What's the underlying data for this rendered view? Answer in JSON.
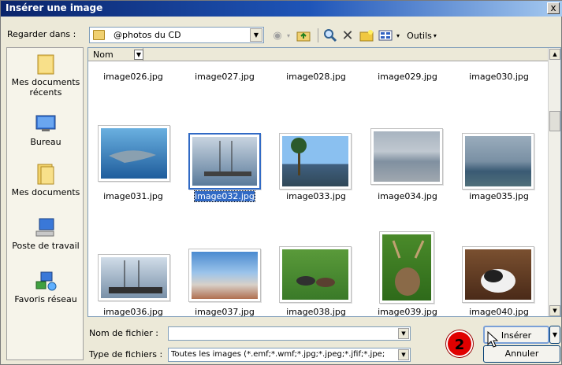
{
  "window": {
    "title": "Insérer une image",
    "close_label": "x"
  },
  "toolbar": {
    "look_in_label": "Regarder dans :",
    "look_in_value": "@photos du CD",
    "tools_label": "Outils"
  },
  "places": [
    {
      "label": "Mes documents récents",
      "icon": "recent-documents-icon"
    },
    {
      "label": "Bureau",
      "icon": "desktop-icon"
    },
    {
      "label": "Mes documents",
      "icon": "my-documents-icon"
    },
    {
      "label": "Poste de travail",
      "icon": "my-computer-icon"
    },
    {
      "label": "Favoris réseau",
      "icon": "network-places-icon"
    }
  ],
  "files": {
    "column_header": "Nom",
    "row1": [
      "image026.jpg",
      "image027.jpg",
      "image028.jpg",
      "image029.jpg",
      "image030.jpg"
    ],
    "row2": [
      "image031.jpg",
      "image032.jpg",
      "image033.jpg",
      "image034.jpg",
      "image035.jpg"
    ],
    "row3": [
      "image036.jpg",
      "image037.jpg",
      "image038.jpg",
      "image039.jpg",
      "image040.jpg"
    ],
    "selected": "image032.jpg"
  },
  "filename": {
    "label": "Nom de fichier :",
    "value": ""
  },
  "filetype": {
    "label": "Type de fichiers :",
    "value": "Toutes les images (*.emf;*.wmf;*.jpg;*.jpeg;*.jfif;*.jpe;"
  },
  "buttons": {
    "insert": "Insérer",
    "cancel": "Annuler"
  },
  "annotation": {
    "step": "2"
  }
}
